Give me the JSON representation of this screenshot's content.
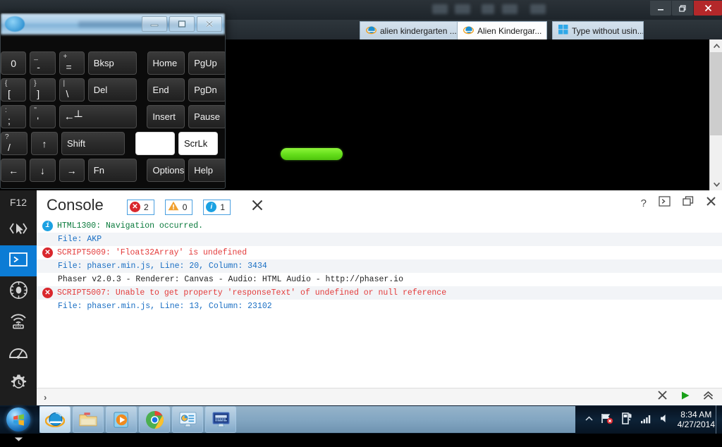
{
  "browser": {
    "window_buttons": [
      "minimize",
      "restore",
      "close"
    ],
    "address_bar": {
      "value": "",
      "placeholder": ""
    },
    "search_icon": "magnifier-icon",
    "refresh_icon": "refresh-icon",
    "tabs": [
      {
        "label": "alien kindergarten ...",
        "active": false,
        "icon": "ie-icon",
        "closable": false
      },
      {
        "label": "Alien Kindergar...",
        "active": true,
        "icon": "ie-icon",
        "closable": true
      },
      {
        "label": "Type without usin...",
        "active": false,
        "icon": "windows-icon",
        "closable": false
      }
    ],
    "command_icons": [
      "home-icon",
      "favorites-star-icon",
      "tools-gear-icon"
    ]
  },
  "page": {
    "background": "#000000",
    "progress_bar_color": "#7ae52a"
  },
  "osk": {
    "title": "",
    "window_buttons": [
      "minimize",
      "restore",
      "close"
    ],
    "rows": [
      [
        {
          "main": "0",
          "sub": "",
          "w": 38
        },
        {
          "main": "-",
          "sub": "_",
          "w": 38
        },
        {
          "main": "=",
          "sub": "+",
          "w": 38
        },
        {
          "main": "Bksp",
          "sub": "",
          "w": 72,
          "label": true
        },
        {
          "main": "",
          "sub": "",
          "w": 5,
          "gap": true
        },
        {
          "main": "Home",
          "sub": "",
          "w": 56,
          "label": true
        },
        {
          "main": "PgUp",
          "sub": "",
          "w": 56,
          "label": true
        }
      ],
      [
        {
          "main": "[",
          "sub": "{",
          "w": 38
        },
        {
          "main": "]",
          "sub": "}",
          "w": 38
        },
        {
          "main": "\\",
          "sub": "|",
          "w": 38
        },
        {
          "main": "Del",
          "sub": "",
          "w": 72,
          "label": true
        },
        {
          "main": "",
          "sub": "",
          "w": 5,
          "gap": true
        },
        {
          "main": "End",
          "sub": "",
          "w": 56,
          "label": true
        },
        {
          "main": "PgDn",
          "sub": "",
          "w": 56,
          "label": true
        }
      ],
      [
        {
          "main": ";",
          "sub": ":",
          "w": 38
        },
        {
          "main": "'",
          "sub": "\"",
          "w": 38
        },
        {
          "main": "←┴",
          "sub": "",
          "w": 115,
          "enter": true
        },
        {
          "main": "",
          "sub": "",
          "w": 5,
          "gap": true
        },
        {
          "main": "Insert",
          "sub": "",
          "w": 56,
          "label": true
        },
        {
          "main": "Pause",
          "sub": "",
          "w": 56,
          "label": true
        }
      ],
      [
        {
          "main": "/",
          "sub": "?",
          "w": 38
        },
        {
          "main": "↑",
          "sub": "",
          "w": 38
        },
        {
          "main": "Shift",
          "sub": "",
          "w": 90,
          "label": true
        },
        {
          "main": "",
          "sub": "",
          "w": 5,
          "gap": true
        },
        {
          "main": "",
          "sub": "",
          "w": 56,
          "lit": true
        },
        {
          "main": "ScrLk",
          "sub": "",
          "w": 56,
          "label": true,
          "lit": true
        }
      ],
      [
        {
          "main": "←",
          "sub": "",
          "w": 38
        },
        {
          "main": "↓",
          "sub": "",
          "w": 38
        },
        {
          "main": "→",
          "sub": "",
          "w": 38
        },
        {
          "main": "Fn",
          "sub": "",
          "w": 72,
          "label": true
        },
        {
          "main": "",
          "sub": "",
          "w": 5,
          "gap": true
        },
        {
          "main": "Options",
          "sub": "",
          "w": 56,
          "label": true
        },
        {
          "main": "Help",
          "sub": "",
          "w": 56,
          "label": true
        }
      ]
    ]
  },
  "devtools": {
    "rail_label": "F12",
    "rail_items": [
      {
        "name": "dom-explorer",
        "icon": "cursor-brackets-icon",
        "selected": false
      },
      {
        "name": "console",
        "icon": "console-prompt-icon",
        "selected": true
      },
      {
        "name": "debugger",
        "icon": "bug-icon",
        "selected": false
      },
      {
        "name": "network",
        "icon": "wifi-router-icon",
        "selected": false
      },
      {
        "name": "performance",
        "icon": "gauge-icon",
        "selected": false
      },
      {
        "name": "ui-responsiveness",
        "icon": "clock-gear-icon",
        "selected": false
      },
      {
        "name": "memory",
        "icon": "camera-icon",
        "selected": false
      },
      {
        "name": "more",
        "icon": "chevron-down-icon",
        "selected": false
      }
    ],
    "panel_title": "Console",
    "badges": [
      {
        "type": "error",
        "count": "2",
        "color": "#d9272d",
        "glyph": "✕"
      },
      {
        "type": "warning",
        "count": "0",
        "color": "#f0a030",
        "glyph": "!"
      },
      {
        "type": "info",
        "count": "1",
        "color": "#1ba1e2",
        "glyph": "i"
      }
    ],
    "clear_label": "✕",
    "header_icons": [
      "help-icon",
      "console-toggle-icon",
      "undock-icon",
      "close-icon"
    ],
    "messages": [
      {
        "icon": "info-icon",
        "text": "HTML1300: Navigation occurred.",
        "style": "green",
        "indent": false
      },
      {
        "icon": "",
        "text": "File: AKP",
        "style": "blue",
        "indent": true
      },
      {
        "icon": "error-icon",
        "text": "SCRIPT5009: 'Float32Array' is undefined",
        "style": "red",
        "indent": false
      },
      {
        "icon": "",
        "text": "File: phaser.min.js, Line: 20, Column: 3434",
        "style": "blue",
        "indent": true
      },
      {
        "icon": "",
        "text": "Phaser v2.0.3 - Renderer: Canvas - Audio: HTML Audio - http://phaser.io",
        "style": "dark",
        "indent": true
      },
      {
        "icon": "error-icon",
        "text": "SCRIPT5007: Unable to get property 'responseText' of undefined or null reference",
        "style": "red",
        "indent": false
      },
      {
        "icon": "",
        "text": "File: phaser.min.js, Line: 13, Column: 23102",
        "style": "blue",
        "indent": true
      }
    ],
    "input": {
      "prompt": "›",
      "value": "",
      "placeholder": ""
    },
    "input_actions": [
      "clear-icon",
      "run-icon",
      "expand-icon"
    ]
  },
  "taskbar": {
    "start_label": "start-orb",
    "items": [
      {
        "name": "internet-explorer",
        "icon": "ie-icon",
        "active": true
      },
      {
        "name": "file-explorer",
        "icon": "folder-icon",
        "active": false
      },
      {
        "name": "media-player",
        "icon": "media-player-icon",
        "active": false
      },
      {
        "name": "google-chrome",
        "icon": "chrome-icon",
        "active": false
      },
      {
        "name": "ease-of-access-center",
        "icon": "ease-of-access-icon",
        "active": false
      },
      {
        "name": "on-screen-keyboard",
        "icon": "osk-icon",
        "active": false
      }
    ],
    "tray_icons": [
      "show-hidden-icon",
      "network-problem-icon",
      "action-center-icon",
      "signal-icon",
      "volume-icon"
    ],
    "clock": {
      "time": "8:34 AM",
      "date": "4/27/2014"
    }
  }
}
